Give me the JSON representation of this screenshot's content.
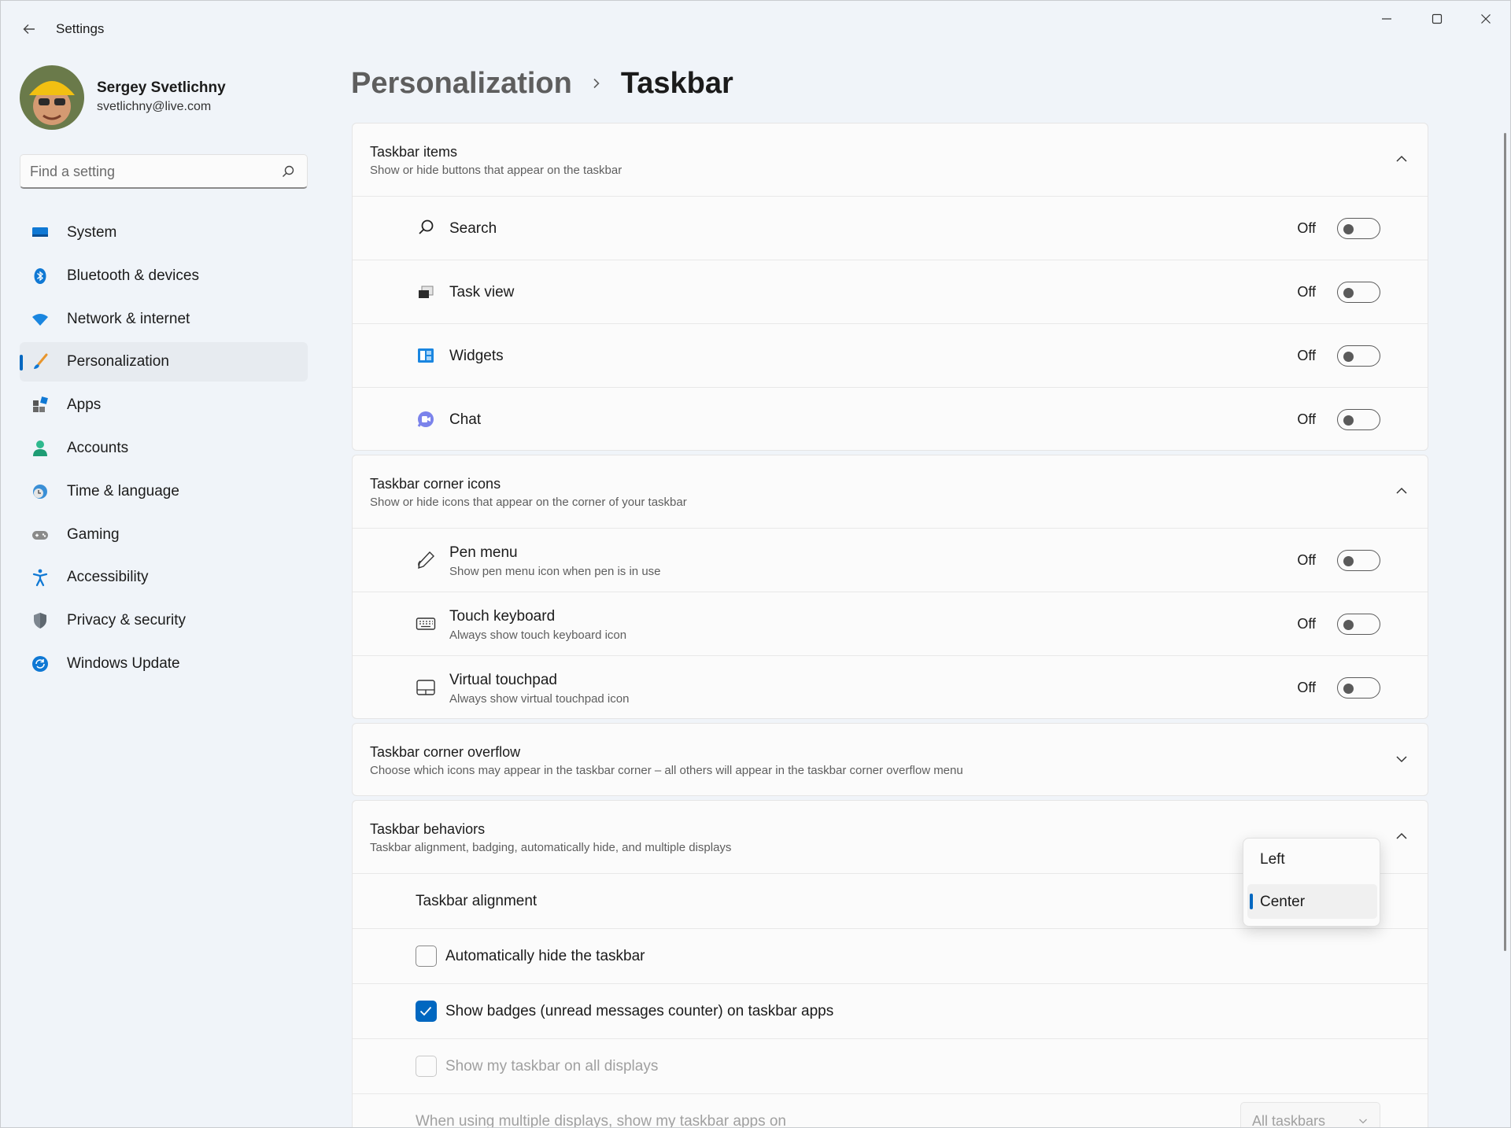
{
  "window": {
    "title": "Settings"
  },
  "user": {
    "name": "Sergey Svetlichny",
    "email": "svetlichny@live.com"
  },
  "search": {
    "placeholder": "Find a setting"
  },
  "sidebar": {
    "items": [
      {
        "label": "System",
        "icon": "system-icon"
      },
      {
        "label": "Bluetooth & devices",
        "icon": "bluetooth-icon"
      },
      {
        "label": "Network & internet",
        "icon": "wifi-icon"
      },
      {
        "label": "Personalization",
        "icon": "brush-icon",
        "selected": true
      },
      {
        "label": "Apps",
        "icon": "apps-icon"
      },
      {
        "label": "Accounts",
        "icon": "accounts-icon"
      },
      {
        "label": "Time & language",
        "icon": "time-language-icon"
      },
      {
        "label": "Gaming",
        "icon": "gaming-icon"
      },
      {
        "label": "Accessibility",
        "icon": "accessibility-icon"
      },
      {
        "label": "Privacy & security",
        "icon": "shield-icon"
      },
      {
        "label": "Windows Update",
        "icon": "windows-update-icon"
      }
    ]
  },
  "breadcrumb": {
    "parent": "Personalization",
    "current": "Taskbar"
  },
  "taskbar_items": {
    "title": "Taskbar items",
    "subtitle": "Show or hide buttons that appear on the taskbar",
    "rows": [
      {
        "label": "Search",
        "state": "Off",
        "icon": "search-icon"
      },
      {
        "label": "Task view",
        "state": "Off",
        "icon": "task-view-icon"
      },
      {
        "label": "Widgets",
        "state": "Off",
        "icon": "widgets-icon"
      },
      {
        "label": "Chat",
        "state": "Off",
        "icon": "chat-icon"
      }
    ]
  },
  "corner_icons": {
    "title": "Taskbar corner icons",
    "subtitle": "Show or hide icons that appear on the corner of your taskbar",
    "rows": [
      {
        "label": "Pen menu",
        "desc": "Show pen menu icon when pen is in use",
        "state": "Off",
        "icon": "pen-icon"
      },
      {
        "label": "Touch keyboard",
        "desc": "Always show touch keyboard icon",
        "state": "Off",
        "icon": "keyboard-icon"
      },
      {
        "label": "Virtual touchpad",
        "desc": "Always show virtual touchpad icon",
        "state": "Off",
        "icon": "touchpad-icon"
      }
    ]
  },
  "corner_overflow": {
    "title": "Taskbar corner overflow",
    "subtitle": "Choose which icons may appear in the taskbar corner – all others will appear in the taskbar corner overflow menu"
  },
  "behaviors": {
    "title": "Taskbar behaviors",
    "subtitle": "Taskbar alignment, badging, automatically hide, and multiple displays",
    "alignment_label": "Taskbar alignment",
    "alignment_options": [
      "Left",
      "Center"
    ],
    "alignment_selected": "Center",
    "auto_hide_label": "Automatically hide the taskbar",
    "auto_hide_checked": false,
    "badges_label": "Show badges (unread messages counter) on taskbar apps",
    "badges_checked": true,
    "all_displays_label": "Show my taskbar on all displays",
    "all_displays_checked": false,
    "multi_display_label": "When using multiple displays, show my taskbar apps on",
    "multi_display_value": "All taskbars"
  },
  "colors": {
    "accent": "#0067c0",
    "background": "#f0f4f9",
    "card": "#fbfbfb"
  }
}
